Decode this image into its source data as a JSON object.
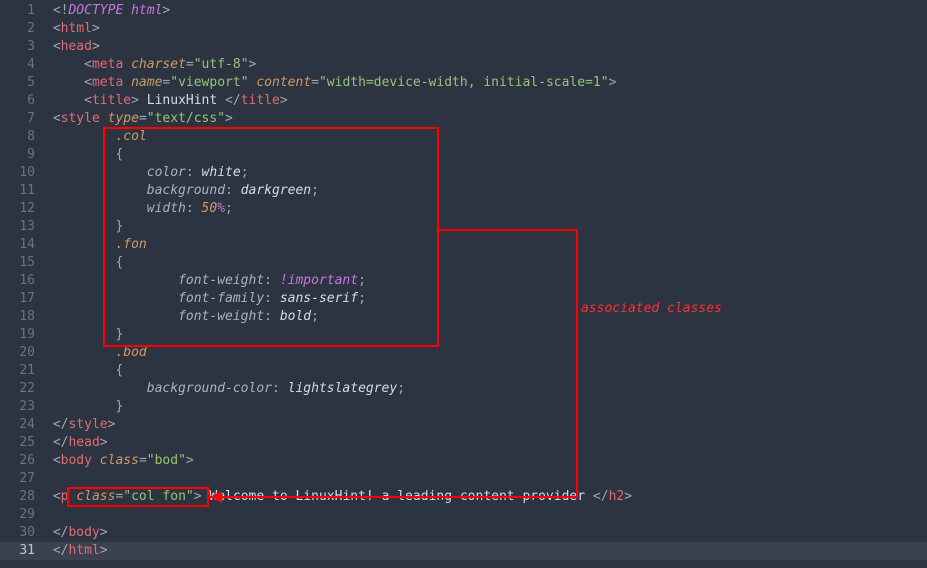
{
  "line_numbers": [
    "1",
    "2",
    "3",
    "4",
    "5",
    "6",
    "7",
    "8",
    "9",
    "10",
    "11",
    "12",
    "13",
    "14",
    "15",
    "16",
    "17",
    "18",
    "19",
    "20",
    "21",
    "22",
    "23",
    "24",
    "25",
    "26",
    "27",
    "28",
    "29",
    "30",
    "31"
  ],
  "current_line_index": 30,
  "code": {
    "doctype": "DOCTYPE html",
    "tag_html_open": "html",
    "tag_head_open": "head",
    "tag_meta": "meta",
    "attr_charset": "charset",
    "val_utf8": "\"utf-8\"",
    "attr_name": "name",
    "val_viewport": "\"viewport\"",
    "attr_content": "content",
    "val_content": "\"width=device-width, initial-scale=1\"",
    "tag_title": "title",
    "title_text": " LinuxHint ",
    "tag_style": "style",
    "attr_type": "type",
    "val_textcss": "\"text/css\"",
    "sel_col": ".col",
    "brace_open": "{",
    "prop_color": "color",
    "val_white": "white",
    "prop_background": "background",
    "val_darkgreen": "darkgreen",
    "prop_width": "width",
    "num_50": "50",
    "pct": "%",
    "brace_close": "}",
    "sel_fon": ".fon",
    "prop_fontweight": "font-weight",
    "kw_important": "!important",
    "prop_fontfamily": "font-family",
    "val_sansserif": "sans-serif",
    "val_bold": "bold",
    "sel_bod": ".bod",
    "prop_bgcolor": "background-color",
    "val_lsgrey": "lightslategrey",
    "tag_style_close": "style",
    "tag_head_close": "head",
    "tag_body": "body",
    "attr_class": "class",
    "val_bod": "\"bod\"",
    "tag_p": "p",
    "val_colfon": "\"col fon\"",
    "p_text": " Welcome to LinuxHint! a leading content provider ",
    "tag_h2_close": "h2",
    "tag_body_close": "body",
    "tag_html_close": "html"
  },
  "annotation": {
    "label": "associated classes"
  }
}
